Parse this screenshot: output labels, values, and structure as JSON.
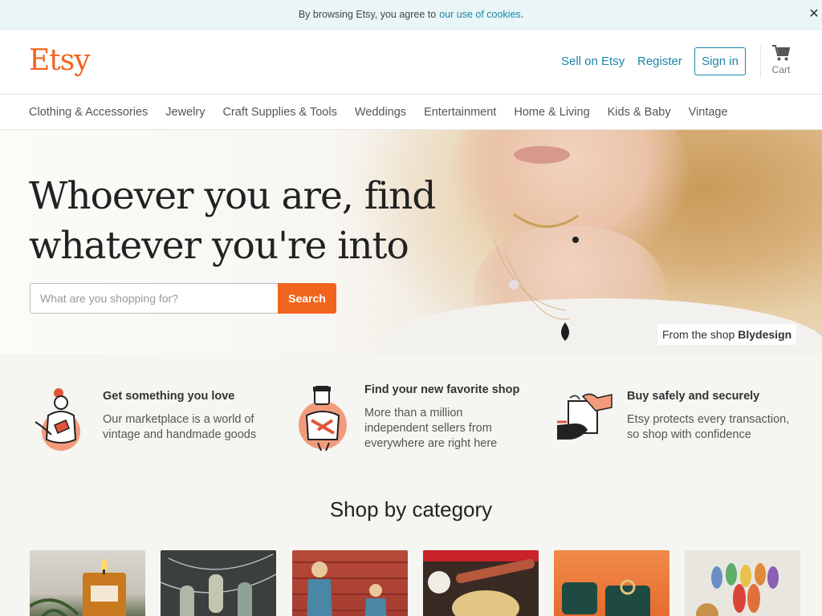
{
  "cookie_banner": {
    "text": "By browsing Etsy, you agree to",
    "link": "our use of cookies",
    "suffix": "."
  },
  "header": {
    "logo": "Etsy",
    "sell_link": "Sell on Etsy",
    "register_link": "Register",
    "signin_button": "Sign in",
    "cart_label": "Cart"
  },
  "nav": {
    "items": [
      "Clothing & Accessories",
      "Jewelry",
      "Craft Supplies & Tools",
      "Weddings",
      "Entertainment",
      "Home & Living",
      "Kids & Baby",
      "Vintage"
    ]
  },
  "hero": {
    "headline_line1": "Whoever you are, find",
    "headline_line2": "whatever you're into",
    "search_placeholder": "What are you shopping for?",
    "search_button": "Search",
    "credit_prefix": "From the shop",
    "credit_shop": "Blydesign"
  },
  "value_props": [
    {
      "title": "Get something you love",
      "desc": "Our marketplace is a world of vintage and handmade goods"
    },
    {
      "title": "Find your new favorite shop",
      "desc": "More than a million independent sellers from everywhere are right here"
    },
    {
      "title": "Buy safely and securely",
      "desc": "Etsy protects every transaction, so shop with confidence"
    }
  ],
  "shop_by_category": {
    "title": "Shop by category"
  },
  "colors": {
    "brand_orange": "#f1641e",
    "link_teal": "#1a86a6",
    "cookie_bg": "#eaf5f8",
    "page_bg": "#f5f5f1"
  }
}
